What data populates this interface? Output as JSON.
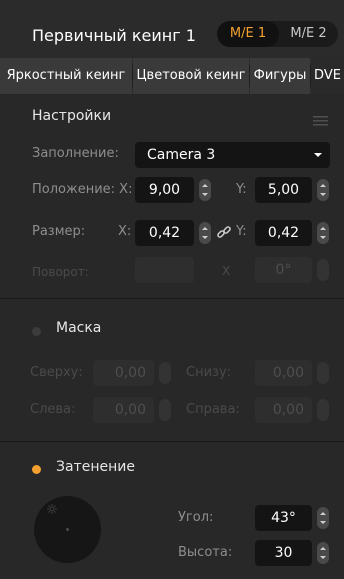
{
  "header": {
    "title": "Первичный кеинг 1",
    "me_buttons": [
      "M/E 1",
      "M/E 2"
    ]
  },
  "tabs": [
    "Яркостный кеинг",
    "Цветовой кеинг",
    "Фигуры",
    "DVE"
  ],
  "settings": {
    "title": "Настройки",
    "fill_label": "Заполнение:",
    "fill_value": "Camera 3",
    "position_label": "Положение: X:",
    "position_x": "9,00",
    "position_y_label": "Y:",
    "position_y": "5,00",
    "size_label": "Размер:",
    "size_x_label": "X:",
    "size_x": "0,42",
    "size_y_label": "Y:",
    "size_y": "0,42",
    "rotation_label": "Поворот:",
    "rotation_x_label": "X",
    "rotation_value": "0°"
  },
  "mask": {
    "title": "Маска",
    "top_label": "Сверху:",
    "top_value": "0,00",
    "bottom_label": "Снизу:",
    "bottom_value": "0,00",
    "left_label": "Слева:",
    "left_value": "0,00",
    "right_label": "Справа:",
    "right_value": "0,00"
  },
  "shadow": {
    "title": "Затенение",
    "angle_label": "Угол:",
    "angle_value": "43°",
    "height_label": "Высота:",
    "height_value": "30"
  },
  "colors": {
    "accent_orange": "#f3a031",
    "background": "#282828",
    "field": "#141414"
  }
}
